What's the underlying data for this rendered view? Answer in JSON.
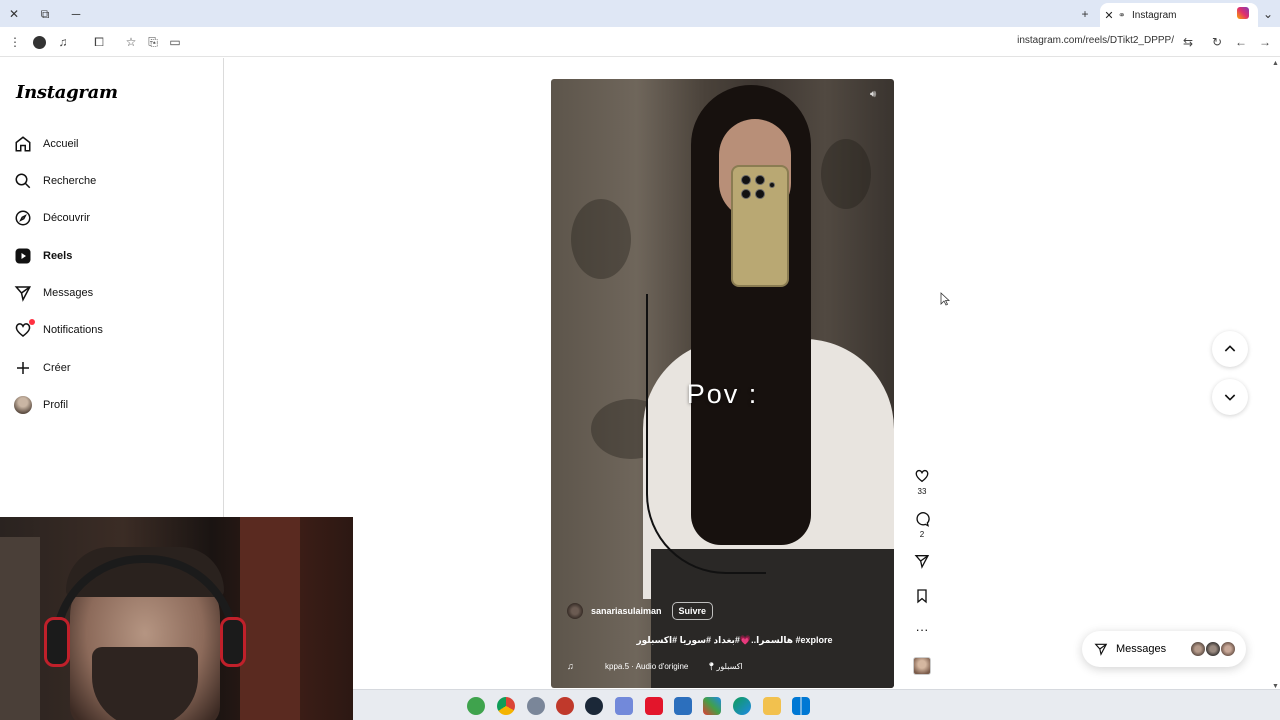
{
  "browser": {
    "tab_title": "Instagram",
    "url": "instagram.com/reels/DTikt2_DPPP/"
  },
  "sidebar": {
    "logo": "Instagram",
    "items": [
      {
        "label": "Accueil",
        "icon": "home-icon"
      },
      {
        "label": "Recherche",
        "icon": "search-icon"
      },
      {
        "label": "Découvrir",
        "icon": "compass-icon"
      },
      {
        "label": "Reels",
        "icon": "reels-icon",
        "active": true
      },
      {
        "label": "Messages",
        "icon": "send-icon"
      },
      {
        "label": "Notifications",
        "icon": "heart-icon",
        "has_dot": true
      },
      {
        "label": "Créer",
        "icon": "plus-icon"
      },
      {
        "label": "Profil",
        "icon": "avatar"
      }
    ]
  },
  "reel": {
    "overlay_text": "Pov :",
    "username": "sanariasulaiman",
    "follow_label": "Suivre",
    "caption": "هالسمرا..💗#بغداد #سوريا #اكسبلور #explore",
    "audio": "kppa.5 · Audio d'origine",
    "location": "اكسبلور"
  },
  "actions": {
    "likes": "33",
    "comments": "2"
  },
  "messages_pill": {
    "label": "Messages"
  },
  "colors": {
    "notification_dot": "#ff3040",
    "accent_border": "#dbdbdb"
  }
}
